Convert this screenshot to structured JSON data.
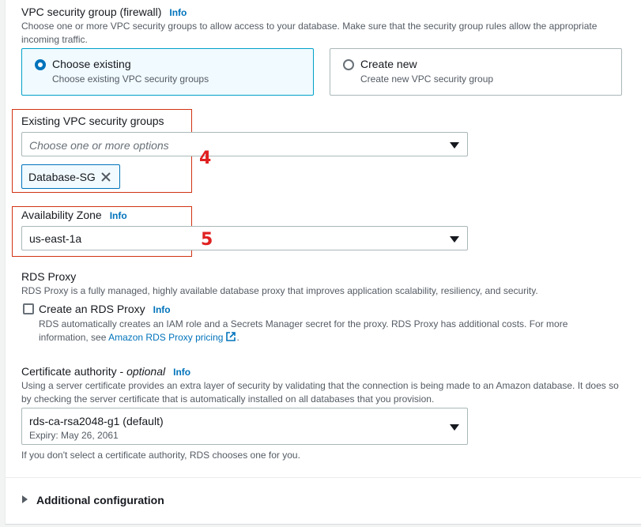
{
  "vpc_sg": {
    "title": "VPC security group (firewall)",
    "info": "Info",
    "description": "Choose one or more VPC security groups to allow access to your database. Make sure that the security group rules allow the appropriate incoming traffic.",
    "options": [
      {
        "title": "Choose existing",
        "desc": "Choose existing VPC security groups",
        "selected": true
      },
      {
        "title": "Create new",
        "desc": "Create new VPC security group",
        "selected": false
      }
    ]
  },
  "existing_sg": {
    "label": "Existing VPC security groups",
    "placeholder": "Choose one or more options",
    "tokens": [
      "Database-SG"
    ],
    "marker": "4"
  },
  "az": {
    "label": "Availability Zone",
    "info": "Info",
    "value": "us-east-1a",
    "marker": "5"
  },
  "rds_proxy": {
    "title": "RDS Proxy",
    "description": "RDS Proxy is a fully managed, highly available database proxy that improves application scalability, resiliency, and security.",
    "checkbox_label": "Create an RDS Proxy",
    "info": "Info",
    "checked": false,
    "help_text": "RDS automatically creates an IAM role and a Secrets Manager secret for the proxy. RDS Proxy has additional costs. For more information, see",
    "link_text": "Amazon RDS Proxy pricing",
    "help_end": "."
  },
  "cert": {
    "label": "Certificate authority",
    "optional": "optional",
    "dash": " - ",
    "info": "Info",
    "description": "Using a server certificate provides an extra layer of security by validating that the connection is being made to an Amazon database. It does so by checking the server certificate that is automatically installed on all databases that you provision.",
    "value": "rds-ca-rsa2048-g1 (default)",
    "sub": "Expiry: May 26, 2061",
    "constraint": "If you don't select a certificate authority, RDS chooses one for you."
  },
  "additional": {
    "label": "Additional configuration"
  },
  "colors": {
    "accent": "#0073bb",
    "marker": "#e02020"
  }
}
